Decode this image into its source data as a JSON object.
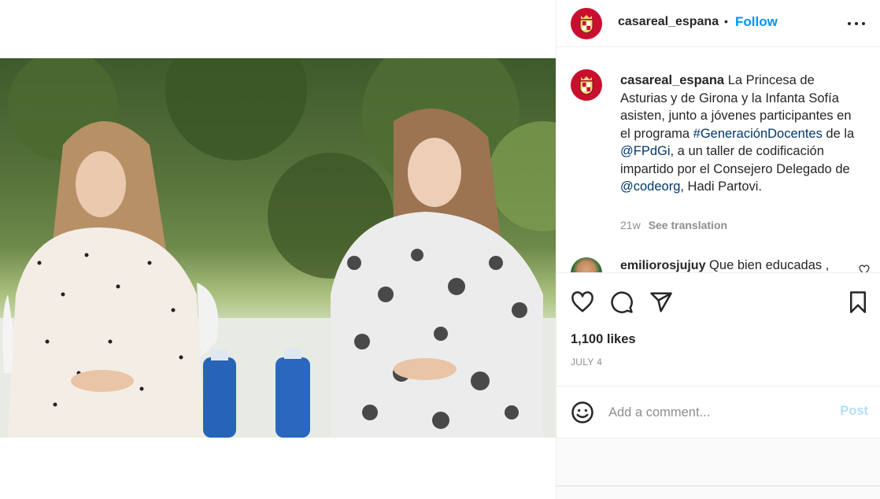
{
  "post": {
    "account": "casareal_espana",
    "separator": "•",
    "follow_label": "Follow",
    "more_icon": "more-options-icon"
  },
  "caption": {
    "username": "casareal_espana",
    "text_1": " La Princesa de Asturias y de Girona y la Infanta Sofía asisten, junto a jóvenes participantes en el programa ",
    "hashtag": "#GeneraciónDocentes",
    "text_2": " de la ",
    "mention_1": "@FPdGi",
    "text_3": ", a un taller de codificación impartido por el Consejero Delegado de ",
    "mention_2": "@codeorg",
    "text_4": ", Hadi Partovi.",
    "age": "21w",
    "see_translation": "See translation"
  },
  "comment_2": {
    "username": "emiliorosjujuy",
    "text": " Que bien educadas ,"
  },
  "actions": {
    "like_icon": "heart-icon",
    "comment_icon": "comment-icon",
    "share_icon": "paper-plane-icon",
    "save_icon": "bookmark-icon"
  },
  "likes": "1,100 likes",
  "date": "JULY 4",
  "add_comment": {
    "placeholder": "Add a comment...",
    "post_label": "Post",
    "emoji_icon": "emoji-icon"
  },
  "colors": {
    "accent": "#0095f6",
    "post_disabled": "#b2dffc",
    "link": "#00376b",
    "avatar_red": "#c8102e"
  }
}
